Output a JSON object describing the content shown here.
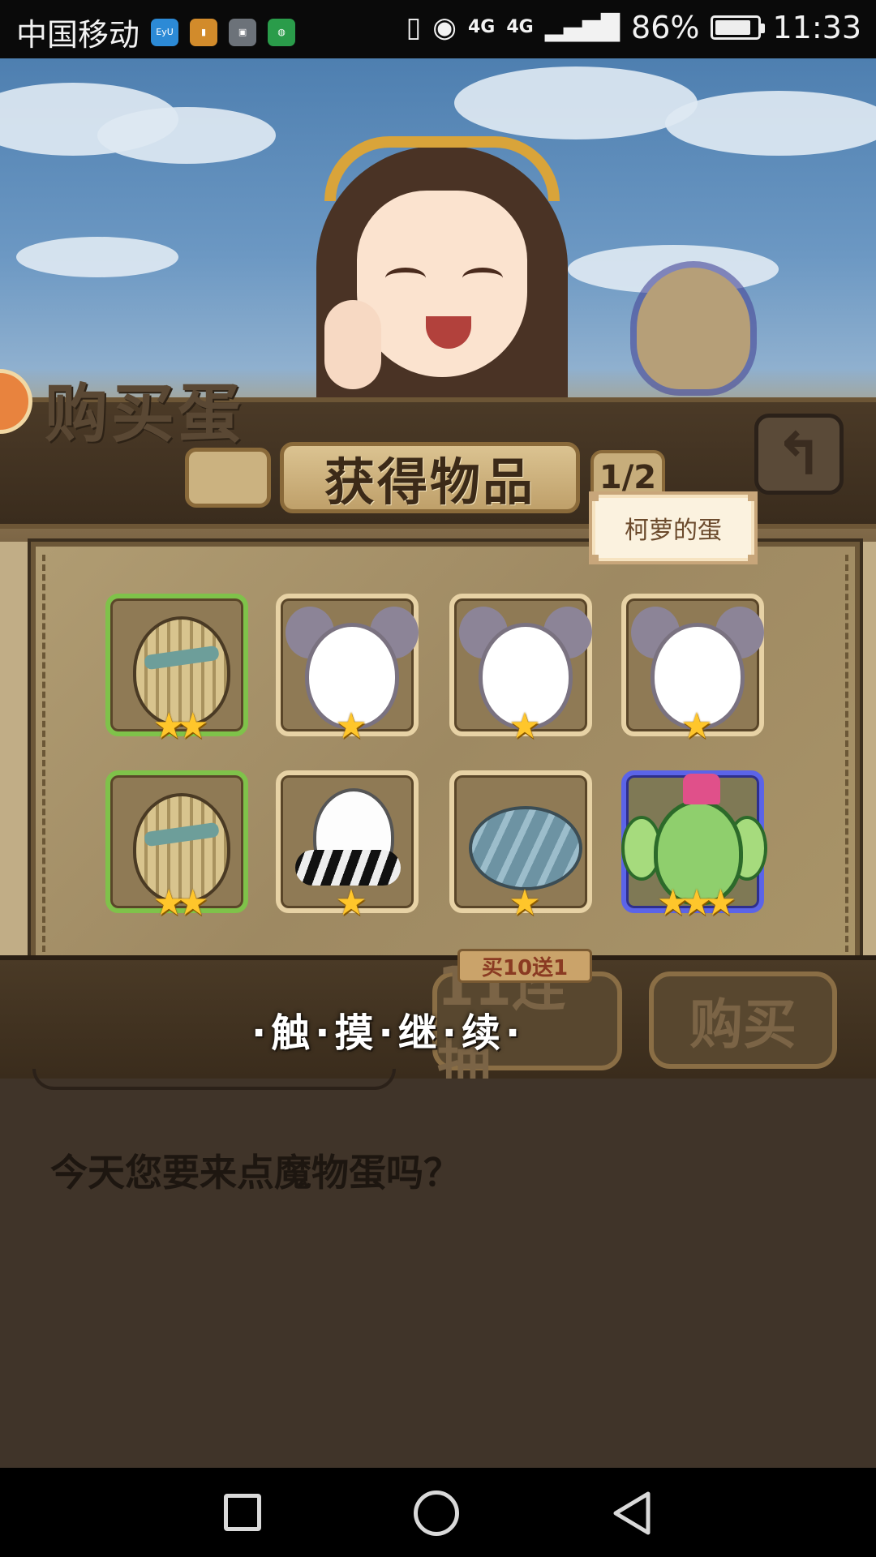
{
  "status_bar": {
    "carrier": "中国移动",
    "notification_icons": [
      "EyU-app-icon",
      "calculator-app-icon",
      "gallery-app-icon",
      "wechat-app-icon"
    ],
    "network": "4G",
    "network2": "4G",
    "battery_percent": "86%",
    "battery_level": 0.86,
    "time": "11:33"
  },
  "header": {
    "buy_egg_title": "购买蛋",
    "items_title": "获得物品",
    "page_indicator": "1/2",
    "back_icon": "undo-arrow-icon"
  },
  "tooltip": {
    "text": "柯萝的蛋"
  },
  "items": [
    {
      "name": "wood-egg",
      "rarity": "green",
      "stars": "★★"
    },
    {
      "name": "koala-egg",
      "rarity": "normal",
      "stars": "★"
    },
    {
      "name": "koala-egg",
      "rarity": "normal",
      "stars": "★"
    },
    {
      "name": "koala-egg",
      "rarity": "normal",
      "stars": "★"
    },
    {
      "name": "wood-egg",
      "rarity": "green",
      "stars": "★★"
    },
    {
      "name": "zebra-egg",
      "rarity": "normal",
      "stars": "★"
    },
    {
      "name": "shell-egg",
      "rarity": "normal",
      "stars": "★"
    },
    {
      "name": "cactus-egg",
      "rarity": "blue",
      "stars": "★★★"
    }
  ],
  "bottom": {
    "continue_text": "·触·摸·继·续·",
    "ten_pull_label": "11连抽",
    "ten_pull_tag": "买10送1",
    "buy_label": "购买"
  },
  "dialog": {
    "text": "今天您要来点魔物蛋吗？"
  },
  "colors": {
    "rarity_green": "#7fc24a",
    "rarity_blue": "#5b64e8",
    "rarity_normal": "#e7d2a5",
    "star": "#ffc62b"
  }
}
